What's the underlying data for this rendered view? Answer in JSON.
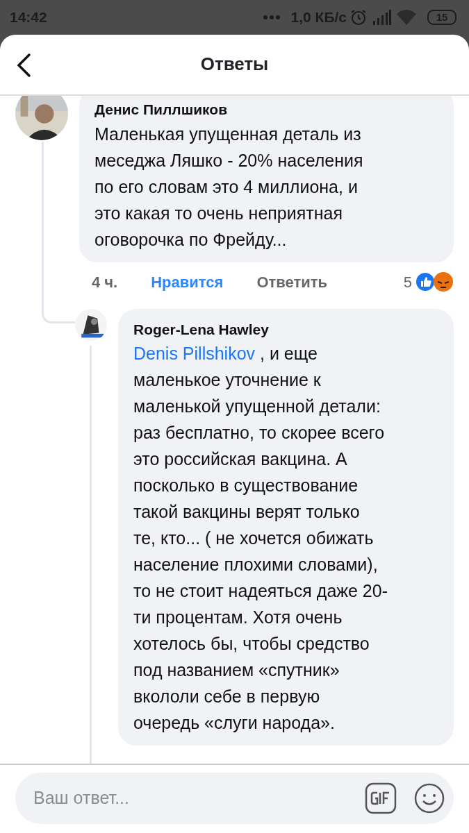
{
  "status_bar": {
    "time": "14:42",
    "speed": "1,0 КБ/с",
    "battery": "15"
  },
  "header": {
    "title": "Ответы"
  },
  "comment": {
    "author": "Денис Пиллшиков",
    "text": "Маленькая упущенная деталь из\nмеседжа Ляшко - 20% населения\nпо его словам это 4 миллиона, и\nэто какая то очень неприятная\nоговорочка по Фрейду...",
    "time": "4 ч.",
    "like": {
      "label": "Нравится",
      "selected": true
    },
    "reply": "Ответить",
    "reaction_count": "5",
    "reactions": [
      {
        "kind": "like"
      },
      {
        "kind": "angry"
      }
    ]
  },
  "reply": {
    "author": "Roger-Lena Hawley",
    "mention": "Denis Pillshikov",
    "text": " , и еще\nмаленькое уточнение к\nмаленькой упущенной детали:\nраз бесплатно, то скорее всего\nэто российская вакцина. А\nпосколько в существование\nтакой вакцины  верят только\nте, кто... ( не хочется обижать\nнаселение плохими словами),\nто не стоит надеяться даже 20-\nти процентам. Хотя очень\nхотелось бы, чтобы средство\nпод названием «спутник»\nвкололи себе в первую\nочередь «слуги народа»."
  },
  "composer": {
    "placeholder": "Ваш ответ..."
  }
}
